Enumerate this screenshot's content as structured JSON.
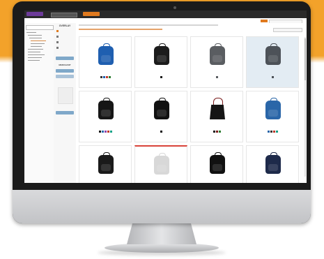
{
  "colors": {
    "brand_band": "#f3a22a",
    "accent": "#e07a1f",
    "highlight": "#e3ecf3",
    "alert": "#d9443a"
  },
  "header": {
    "search_select": "",
    "primary_button": "",
    "link": ""
  },
  "subbar": {
    "user_info": ""
  },
  "sidebar_tree": {
    "search_placeholder": ""
  },
  "nav": {
    "title": "OVERLAY",
    "items": [
      {
        "label": "",
        "icon": "box-icon",
        "active": true
      },
      {
        "label": "",
        "icon": "tag-icon",
        "active": false
      },
      {
        "label": "",
        "icon": "grid-icon",
        "active": false
      },
      {
        "label": "",
        "icon": "people-icon",
        "active": false
      }
    ],
    "section": "MERCHANT"
  },
  "products": [
    {
      "tag": "",
      "name": "",
      "price": "",
      "color": "#1f5fb0",
      "style": "backpack",
      "highlight": false,
      "alert": false,
      "swatches": [
        "#333333",
        "#1f5fb0",
        "#c0392b",
        "#2e7d32"
      ]
    },
    {
      "tag": "",
      "name": "",
      "price": "",
      "color": "#1c1c1c",
      "style": "backpack",
      "highlight": false,
      "alert": false,
      "swatches": [
        "#1c1c1c"
      ]
    },
    {
      "tag": "",
      "name": "",
      "price": "",
      "color": "#5a5d61",
      "style": "backpack",
      "highlight": false,
      "alert": false,
      "swatches": [
        "#5a5d61"
      ]
    },
    {
      "tag": "",
      "name": "",
      "price": "",
      "color": "#4d5258",
      "style": "backpack",
      "highlight": true,
      "alert": false,
      "swatches": [
        "#4d5258"
      ]
    },
    {
      "tag": "",
      "name": "",
      "price": "",
      "color": "#161616",
      "style": "backpack",
      "highlight": false,
      "alert": false,
      "swatches": [
        "#161616",
        "#2a6db0",
        "#8e44ad",
        "#c0392b",
        "#16a085"
      ]
    },
    {
      "tag": "",
      "name": "",
      "price": "",
      "color": "#111111",
      "style": "backpack",
      "highlight": false,
      "alert": false,
      "swatches": [
        "#111111"
      ]
    },
    {
      "tag": "",
      "name": "",
      "price": "",
      "color": "#151515",
      "style": "tote",
      "highlight": false,
      "alert": false,
      "swatches": [
        "#151515",
        "#7a1c1c",
        "#2e7d32"
      ]
    },
    {
      "tag": "",
      "name": "",
      "price": "",
      "color": "#2a66a8",
      "style": "backpack",
      "highlight": false,
      "alert": false,
      "swatches": [
        "#2a66a8",
        "#333333",
        "#c0392b",
        "#16a085"
      ]
    },
    {
      "tag": "",
      "name": "",
      "price": "",
      "color": "#1a1a1a",
      "style": "backpack",
      "highlight": false,
      "alert": false,
      "swatches": []
    },
    {
      "tag": "",
      "name": "",
      "price": "",
      "color": "#d8d8d8",
      "style": "backpack",
      "highlight": false,
      "alert": true,
      "swatches": []
    },
    {
      "tag": "",
      "name": "",
      "price": "",
      "color": "#111111",
      "style": "backpack",
      "highlight": false,
      "alert": false,
      "swatches": []
    },
    {
      "tag": "",
      "name": "",
      "price": "",
      "color": "#1e2a4a",
      "style": "backpack",
      "highlight": false,
      "alert": false,
      "swatches": []
    }
  ]
}
